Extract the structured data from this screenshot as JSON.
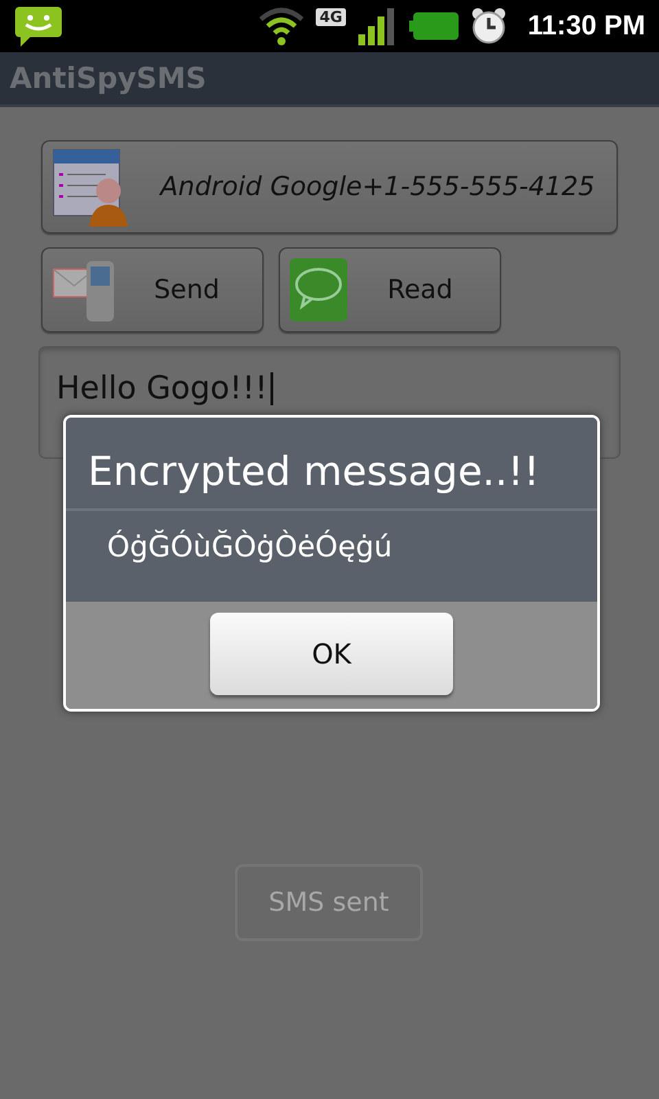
{
  "status_bar": {
    "network": "4G",
    "time": "11:30 PM"
  },
  "title_bar": {
    "title": "AntiSpySMS"
  },
  "form": {
    "contact_button": "Android Google+1-555-555-4125",
    "send_button": "Send",
    "read_button": "Read",
    "message_field": {
      "value": "Hello Gogo!!!"
    }
  },
  "dialog": {
    "title": "Encrypted message..!!",
    "message": "ÓġĞÓùĞÒġÒėÓęġú",
    "ok_button": "OK"
  },
  "toast": "SMS sent"
}
